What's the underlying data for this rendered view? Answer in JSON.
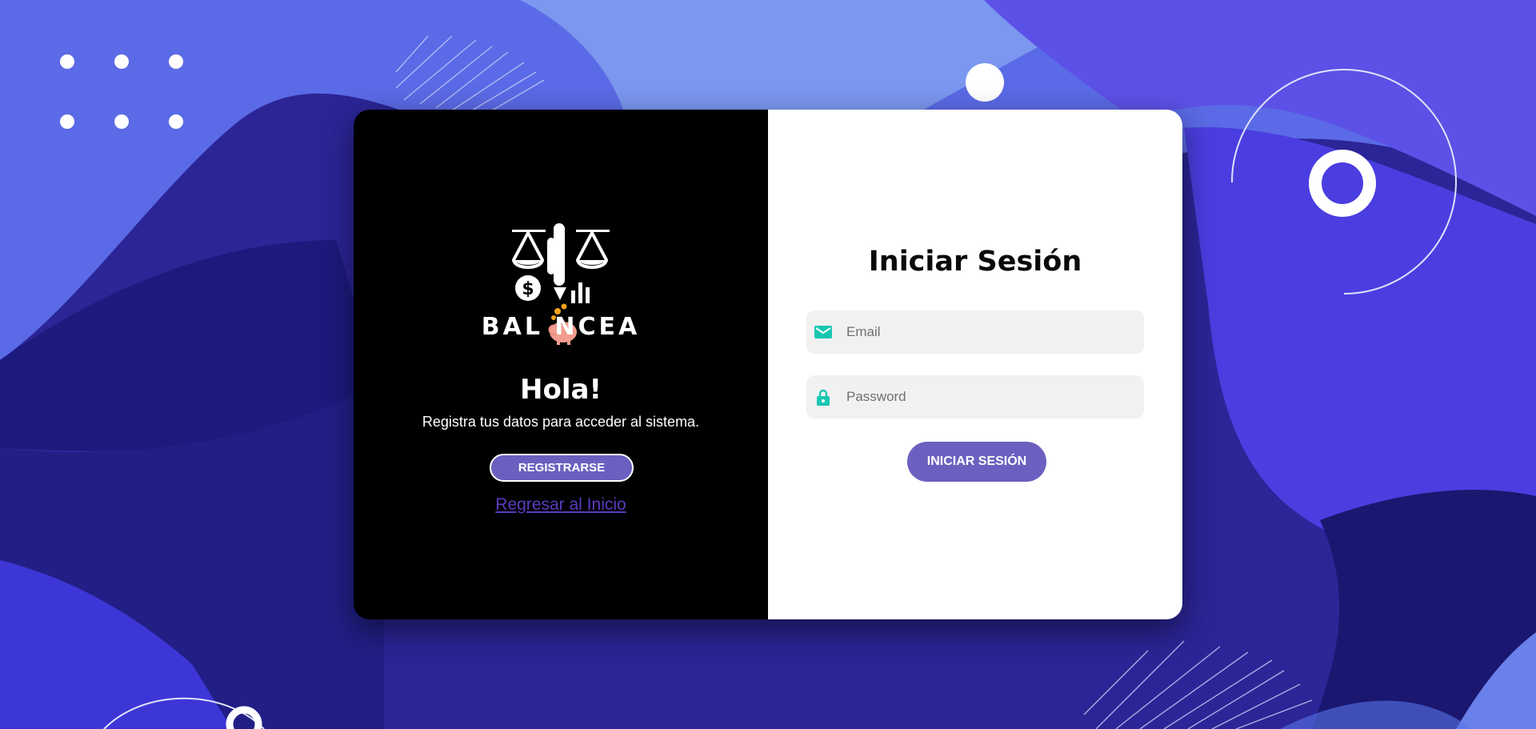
{
  "brand": {
    "logo_text": "BAL NCEA",
    "logo_icon": "balance-scale-piggy-logo"
  },
  "welcome": {
    "heading": "Hola!",
    "subtitle": "Registra tus datos para acceder al sistema.",
    "register_button": "REGISTRARSE",
    "back_link": "Regresar al Inicio"
  },
  "login": {
    "title": "Iniciar Sesión",
    "email_placeholder": "Email",
    "email_icon": "mail-icon",
    "password_placeholder": "Password",
    "password_icon": "lock-icon",
    "submit_button": "INICIAR SESIÓN"
  },
  "colors": {
    "accent": "#6b60bf",
    "icon": "#18c7b0",
    "link": "#5a3bbd",
    "left_panel": "#000000",
    "right_panel": "#ffffff"
  }
}
